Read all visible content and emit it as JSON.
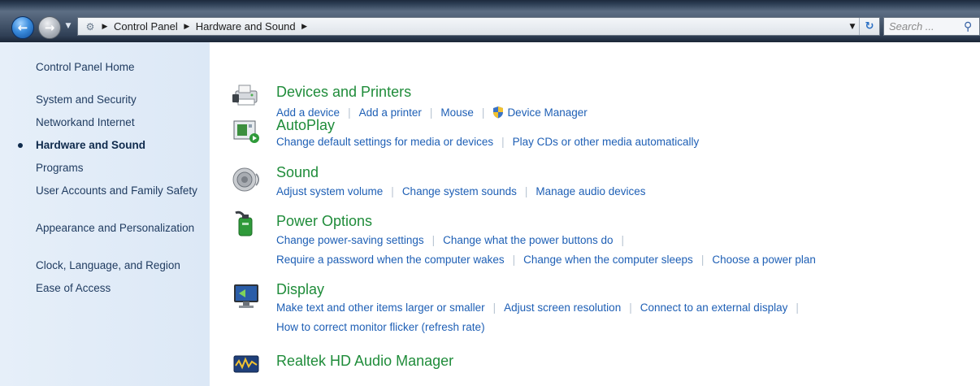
{
  "address_bar": {
    "breadcrumbs": [
      "Control Panel",
      "Hardware and Sound"
    ],
    "search_placeholder": "Search ..."
  },
  "left_nav": {
    "items": [
      {
        "label": "Control Panel Home",
        "current": false
      },
      {
        "label": "System and Security",
        "current": false
      },
      {
        "label": "Networkand Internet",
        "current": false
      },
      {
        "label": "Hardware and Sound",
        "current": true
      },
      {
        "label": "Programs",
        "current": false
      },
      {
        "label": "User Accounts and Family Safety",
        "current": false
      },
      {
        "label": "Appearance and Personalization",
        "current": false
      },
      {
        "label": "Clock, Language, and Region",
        "current": false
      },
      {
        "label": "Ease of Access",
        "current": false
      }
    ]
  },
  "categories": [
    {
      "title": "Devices and Printers",
      "icon": "devices-printers-icon",
      "link_rows": [
        [
          "Add a device",
          "Add a printer",
          "Mouse",
          "Device Manager"
        ]
      ]
    },
    {
      "title": "AutoPlay",
      "icon": "autoplay-icon",
      "link_rows": [
        [
          "Change default settings for media or devices",
          "Play CDs or other media automatically"
        ]
      ]
    },
    {
      "title": "Sound",
      "icon": "speaker-icon",
      "link_rows": [
        [
          "Adjust system volume",
          "Change system sounds",
          "Manage audio devices"
        ]
      ]
    },
    {
      "title": "Power Options",
      "icon": "power-options-icon",
      "link_rows": [
        [
          "Change power-saving settings",
          "Change what the power buttons do"
        ],
        [
          "Require a password when the computer wakes",
          "Change when the computer sleeps",
          "Choose a power plan"
        ]
      ]
    },
    {
      "title": "Display",
      "icon": "display-icon",
      "link_rows": [
        [
          "Make text and other items larger or smaller",
          "Adjust screen resolution",
          "Connect to an external display"
        ],
        [
          "How to correct monitor flicker (refresh rate)"
        ]
      ]
    },
    {
      "title": "Realtek HD Audio Manager",
      "icon": "realtek-audio-icon",
      "link_rows": []
    }
  ],
  "colors": {
    "category_title": "#1f8c3a",
    "link": "#1e5fb5",
    "left_pane_bg": "#dce8f6"
  }
}
